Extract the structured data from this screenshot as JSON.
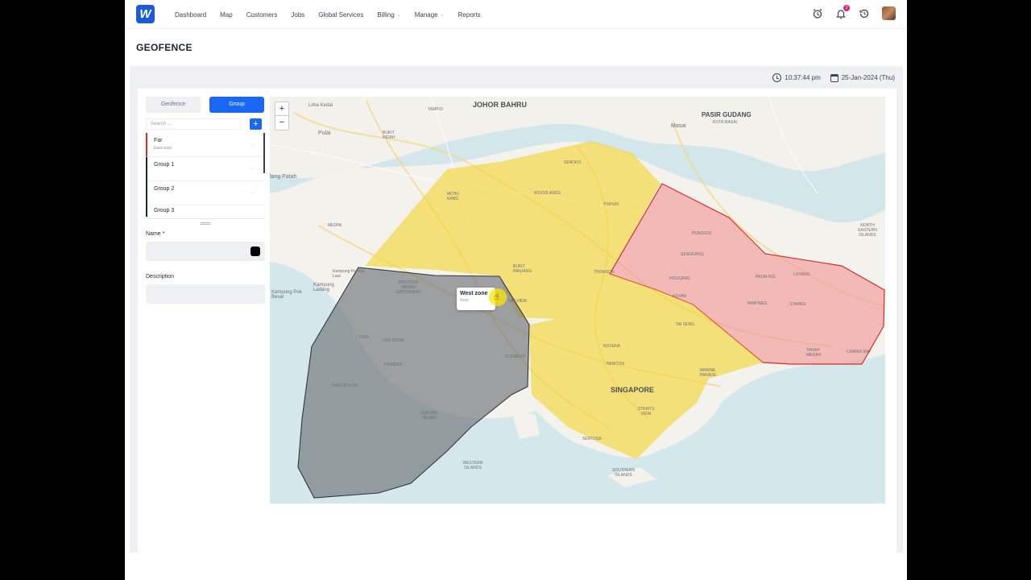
{
  "nav": {
    "items": [
      "Dashboard",
      "Map",
      "Customers",
      "Jobs",
      "Global Services",
      "Billing",
      "Manage",
      "Reports"
    ],
    "dropdown_items": [
      "Billing",
      "Manage"
    ],
    "notification_count": "2"
  },
  "page": {
    "title": "GEOFENCE"
  },
  "datetime": {
    "time": "10:37:44 pm",
    "date": "25-Jan-2024 (Thu)"
  },
  "panel": {
    "tabs": {
      "geofence": "Geofence",
      "group": "Group"
    },
    "active_tab": "Group",
    "search_placeholder": "Search ...",
    "groups": [
      {
        "name": "Far",
        "sub": "East zone"
      },
      {
        "name": "Group 1",
        "sub": ""
      },
      {
        "name": "Group 2",
        "sub": ""
      },
      {
        "name": "Group 3",
        "sub": ""
      }
    ],
    "name_label": "Name *",
    "description_label": "Description",
    "color_value": "#000000"
  },
  "map": {
    "zoom_in": "+",
    "zoom_out": "−",
    "place_labels": {
      "johor_bahru": "JOHOR BAHRU",
      "pasir_gudang": "PASIR GUDANG",
      "kota_masai": "KOTA MASAI",
      "masai": "Masai",
      "lima_kedai": "Lima Kedai",
      "pulai": "Pulai",
      "tampoi": "TAMPOI",
      "bukit_indah": "BUKIT INDAH",
      "lang_patah": "lang Patah",
      "medini": "MEDINI",
      "kampung_pendas": "Kampung Pendas Laut",
      "kampung_pok": "Kampung Pok Besar",
      "kampung_ladang": "Kampung Ladang",
      "senoko": "SENOKO",
      "woodlands": "WOODLANDS",
      "mchu_kang": "MCHU KANG",
      "yishun": "YISHUN",
      "bukit_panjang": "BUKIT PANJANG",
      "thomson": "THOMSON",
      "hillview": "HILLVIEW",
      "western_water": "WESTERN WATER CATCHMENT",
      "tuas": "TUAS",
      "joo_koon": "JOO KOON",
      "pioneer": "PIONEER",
      "tuas_south": "TUAS SOUTH",
      "jurong_island": "JURONG ISLAND",
      "clementi": "CLEMENTI",
      "punggol": "PUNGGOL",
      "sengkang": "SENGKANG",
      "hougang": "HOUGANG",
      "pasir_ris": "PASIR RIS",
      "loyang": "LOYANG",
      "kovan": "KOVAN",
      "tampines": "TAMPINES",
      "changi": "CHANGI",
      "tanah_merah": "TANAH MERAH",
      "changi_bay": "CHANGI BAY",
      "tai_seng": "TAI SENG",
      "novena": "NOVENA",
      "newton": "NEWTON",
      "singapore": "SINGAPORE",
      "marine_parade": "MARINE PARADE",
      "straits_view": "STRAITS VIEW",
      "sentosa": "SENTOSA",
      "western_islands": "WESTERN ISLANDS",
      "southern_islands": "SOUTHERN ISLANDS",
      "north_eastern": "NORTH EASTERN ISLANDS"
    },
    "tooltip": {
      "title": "West zone",
      "sub": "Near"
    },
    "zone_colors": {
      "yellow": "#f5d63a",
      "red": "#f29a9a",
      "red_stroke": "#d62c2c",
      "gray": "#6e7178"
    }
  }
}
